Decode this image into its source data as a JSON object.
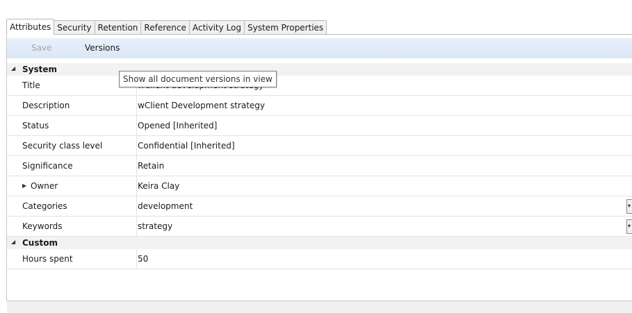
{
  "tabs": [
    "Attributes",
    "Security",
    "Retention",
    "Reference",
    "Activity Log",
    "System Properties"
  ],
  "toolbar": {
    "save_label": "Save",
    "versions_label": "Versions"
  },
  "tooltip": "Show all document versions in view",
  "groups": [
    {
      "name": "System",
      "rows": [
        {
          "label": "Title",
          "value": "wClient development strategy"
        },
        {
          "label": "Description",
          "value": "wClient Development strategy"
        },
        {
          "label": "Status",
          "value": "Opened [Inherited]"
        },
        {
          "label": "Security class level",
          "value": "Confidential [Inherited]"
        },
        {
          "label": "Significance",
          "value": "Retain"
        },
        {
          "label": "Owner",
          "value": "Keira Clay"
        },
        {
          "label": "Categories",
          "value": "development"
        },
        {
          "label": "Keywords",
          "value": "strategy"
        }
      ]
    },
    {
      "name": "Custom",
      "rows": [
        {
          "label": "Hours spent",
          "value": "50"
        }
      ]
    }
  ],
  "icons": {
    "group_collapse": "triangle-down-left-icon",
    "row_expand": "triangle-right-icon",
    "dropdown": "chevron-down-icon"
  }
}
